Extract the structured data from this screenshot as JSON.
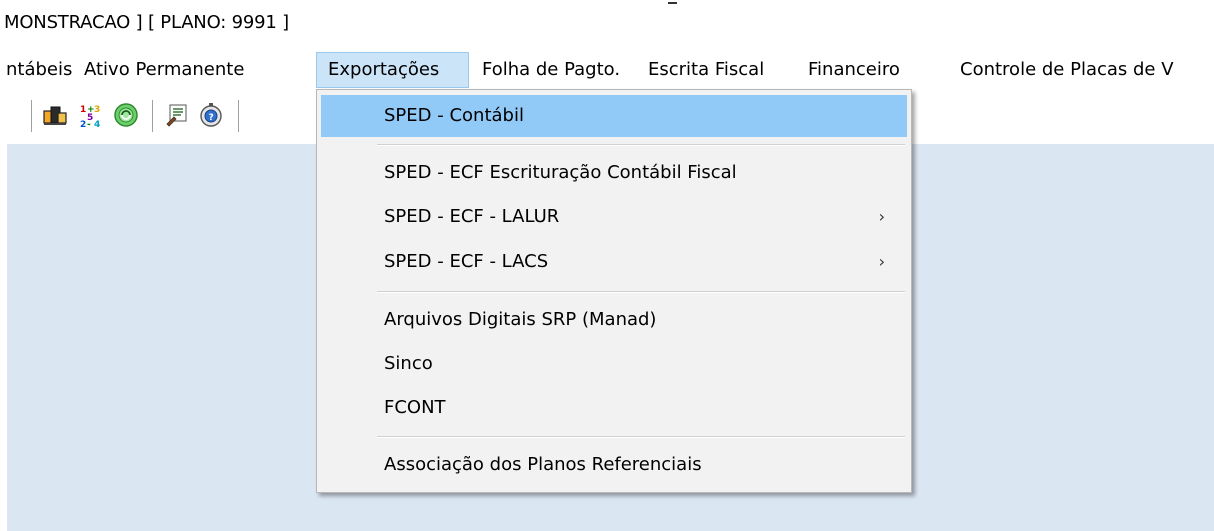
{
  "title": "MONSTRACAO ] [ PLANO: 9991 ]",
  "menu": {
    "items": [
      {
        "label": "ntábeis"
      },
      {
        "label": "Ativo Permanente"
      },
      {
        "label": "Exportações"
      },
      {
        "label": "Folha de Pagto."
      },
      {
        "label": "Escrita Fiscal"
      },
      {
        "label": "Financeiro"
      },
      {
        "label": "Controle de Placas de V"
      }
    ]
  },
  "toolbar": {
    "icons": [
      "chart-cubes-icon",
      "numbers-icon",
      "recycle-icon",
      "report-icon",
      "help-icon"
    ]
  },
  "dropdown": {
    "items": [
      {
        "label": "SPED -  Contábil",
        "highlighted": true
      },
      {
        "label": "SPED - ECF Escrituração Contábil Fiscal"
      },
      {
        "label": "SPED - ECF - LALUR",
        "submenu_arrow": "›"
      },
      {
        "label": "SPED - ECF - LACS",
        "submenu_arrow": "›"
      },
      {
        "label": "Arquivos Digitais SRP (Manad)"
      },
      {
        "label": "Sinco"
      },
      {
        "label": "FCONT"
      },
      {
        "label": "Associação dos Planos Referenciais"
      }
    ]
  },
  "colors": {
    "client_bg": "#dbe6f3",
    "menu_active_bg": "#cce4f7",
    "dropdown_highlight": "#91c9f7",
    "dropdown_bg": "#f2f2f2"
  }
}
